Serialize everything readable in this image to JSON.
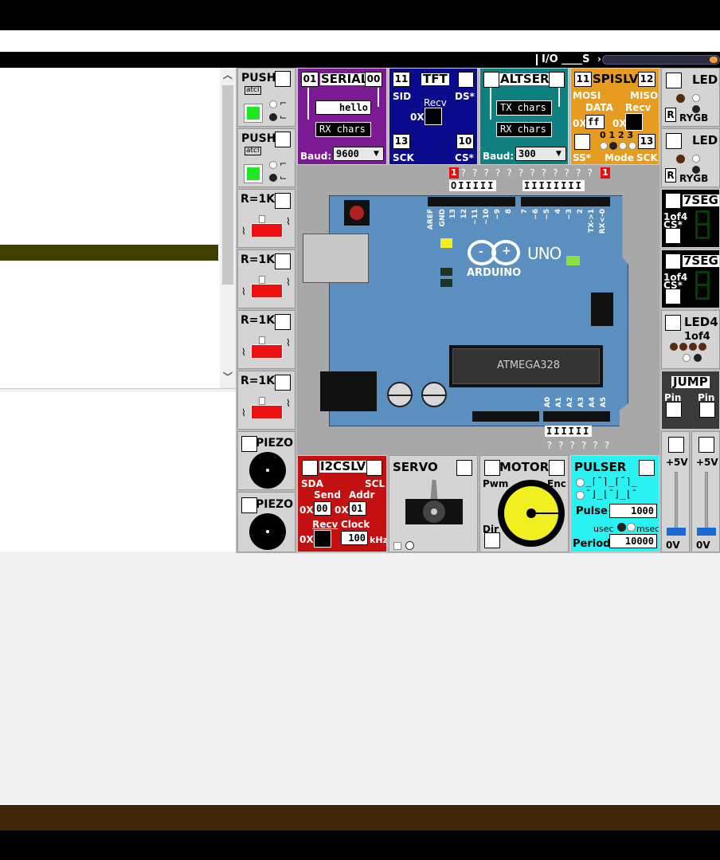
{
  "toolbar": {
    "io_label": "I/O ____S",
    "io_arrow": "›"
  },
  "left_modules": {
    "push1": {
      "title": "PUSH",
      "sub": "atcl"
    },
    "push2": {
      "title": "PUSH",
      "sub": "atcl"
    },
    "res1": {
      "title": "R=1K"
    },
    "res2": {
      "title": "R=1K"
    },
    "res3": {
      "title": "R=1K"
    },
    "res4": {
      "title": "R=1K"
    },
    "piezo1": {
      "title": "PIEZO"
    },
    "piezo2": {
      "title": "PIEZO"
    }
  },
  "top_modules": {
    "serial": {
      "title": "SERIAL",
      "pin_left": "01",
      "pin_right": "00",
      "tx_value": "hello",
      "rx_label": "RX chars",
      "baud_label": "Baud:",
      "baud_value": "9600"
    },
    "tft": {
      "title": "TFT",
      "pin1": "11",
      "pin2": "13",
      "pin3": "10",
      "sid": "SID",
      "ds": "DS*",
      "recv": "Recv",
      "hex": "0X",
      "sck": "SCK",
      "cs": "CS*"
    },
    "altser": {
      "title": "ALTSER",
      "tx_label": "TX chars",
      "rx_label": "RX chars",
      "baud_label": "Baud:",
      "baud_value": "300"
    },
    "spislv": {
      "title": "SPISLV",
      "pin_left": "11",
      "pin_right": "12",
      "mosi": "MOSI",
      "miso": "MISO",
      "data": "DATA",
      "recv": "Recv",
      "hex1": "0X",
      "data_value": "ff",
      "hex2": "0X",
      "modes": "0 1 2 3",
      "pin_13": "13",
      "ss": "SS*",
      "mode": "Mode",
      "sck": "SCK"
    }
  },
  "right_modules": {
    "led1": {
      "title": "LED",
      "r": "R",
      "rygb": "RYGB"
    },
    "led2": {
      "title": "LED",
      "r": "R",
      "rygb": "RYGB"
    },
    "seg1": {
      "title": "7SEG",
      "sub1": "1of4",
      "sub2": "CS*"
    },
    "seg2": {
      "title": "7SEG",
      "sub1": "1of4",
      "sub2": "CS*"
    },
    "led4": {
      "title": "LED4",
      "sub": "1of4"
    },
    "jump": {
      "title": "JUMP",
      "pin_left": "Pin",
      "pin_right": "Pin"
    },
    "slide1": {
      "top": "+5V",
      "bottom": "0V"
    },
    "slide2": {
      "top": "+5V",
      "bottom": "0V"
    }
  },
  "bottom_modules": {
    "i2cslv": {
      "title": "I2CSLV",
      "sda": "SDA",
      "scl": "SCL",
      "send": "Send",
      "addr": "Addr",
      "hex1": "0X",
      "send_value": "00",
      "hex2": "0X",
      "addr_value": "01",
      "recv": "Recv",
      "clock": "Clock",
      "hex3": "0X",
      "clock_value": "100",
      "khz": "kHz"
    },
    "servo": {
      "title": "SERVO"
    },
    "motor": {
      "title": "MOTOR",
      "pwm": "Pwm",
      "enc": "Enc",
      "dir": "Dir"
    },
    "pulser": {
      "title": "PULSER",
      "pulse_label": "Pulse",
      "pulse_value": "1000",
      "usec": "usec",
      "msec": "msec",
      "period_label": "Period",
      "period_value": "10000"
    }
  },
  "board": {
    "digital_marks": "1 ? ? ? ? ?   ? ? ? ? ? ? ? 1",
    "digital_io": "O I I I I I   I I I I I I I I",
    "digital_labels": [
      "AREF",
      "GND",
      "13",
      "12",
      "~11",
      "~10",
      "~9",
      "8",
      "7",
      "~6",
      "~5",
      "4",
      "~3",
      "2",
      "TX->1",
      "RX<-0"
    ],
    "analog_labels": [
      "A0",
      "A1",
      "A2",
      "A3",
      "A4",
      "A5"
    ],
    "analog_io": "I I I I I I",
    "analog_marks": "? ? ? ? ? ?",
    "brand_top": "UNO",
    "brand": "ARDUINO",
    "chip": "ATMEGA328",
    "minus": "-",
    "plus": "+"
  },
  "colors": {
    "serial": "#7b1a93",
    "tft": "#0a0a8c",
    "altser": "#0f7f7f",
    "spislv": "#e59c20",
    "i2c": "#c41010",
    "pulser": "#2af2f2",
    "board": "#5b8fbf",
    "led_on": "#22e022",
    "button": "#ee1111"
  }
}
